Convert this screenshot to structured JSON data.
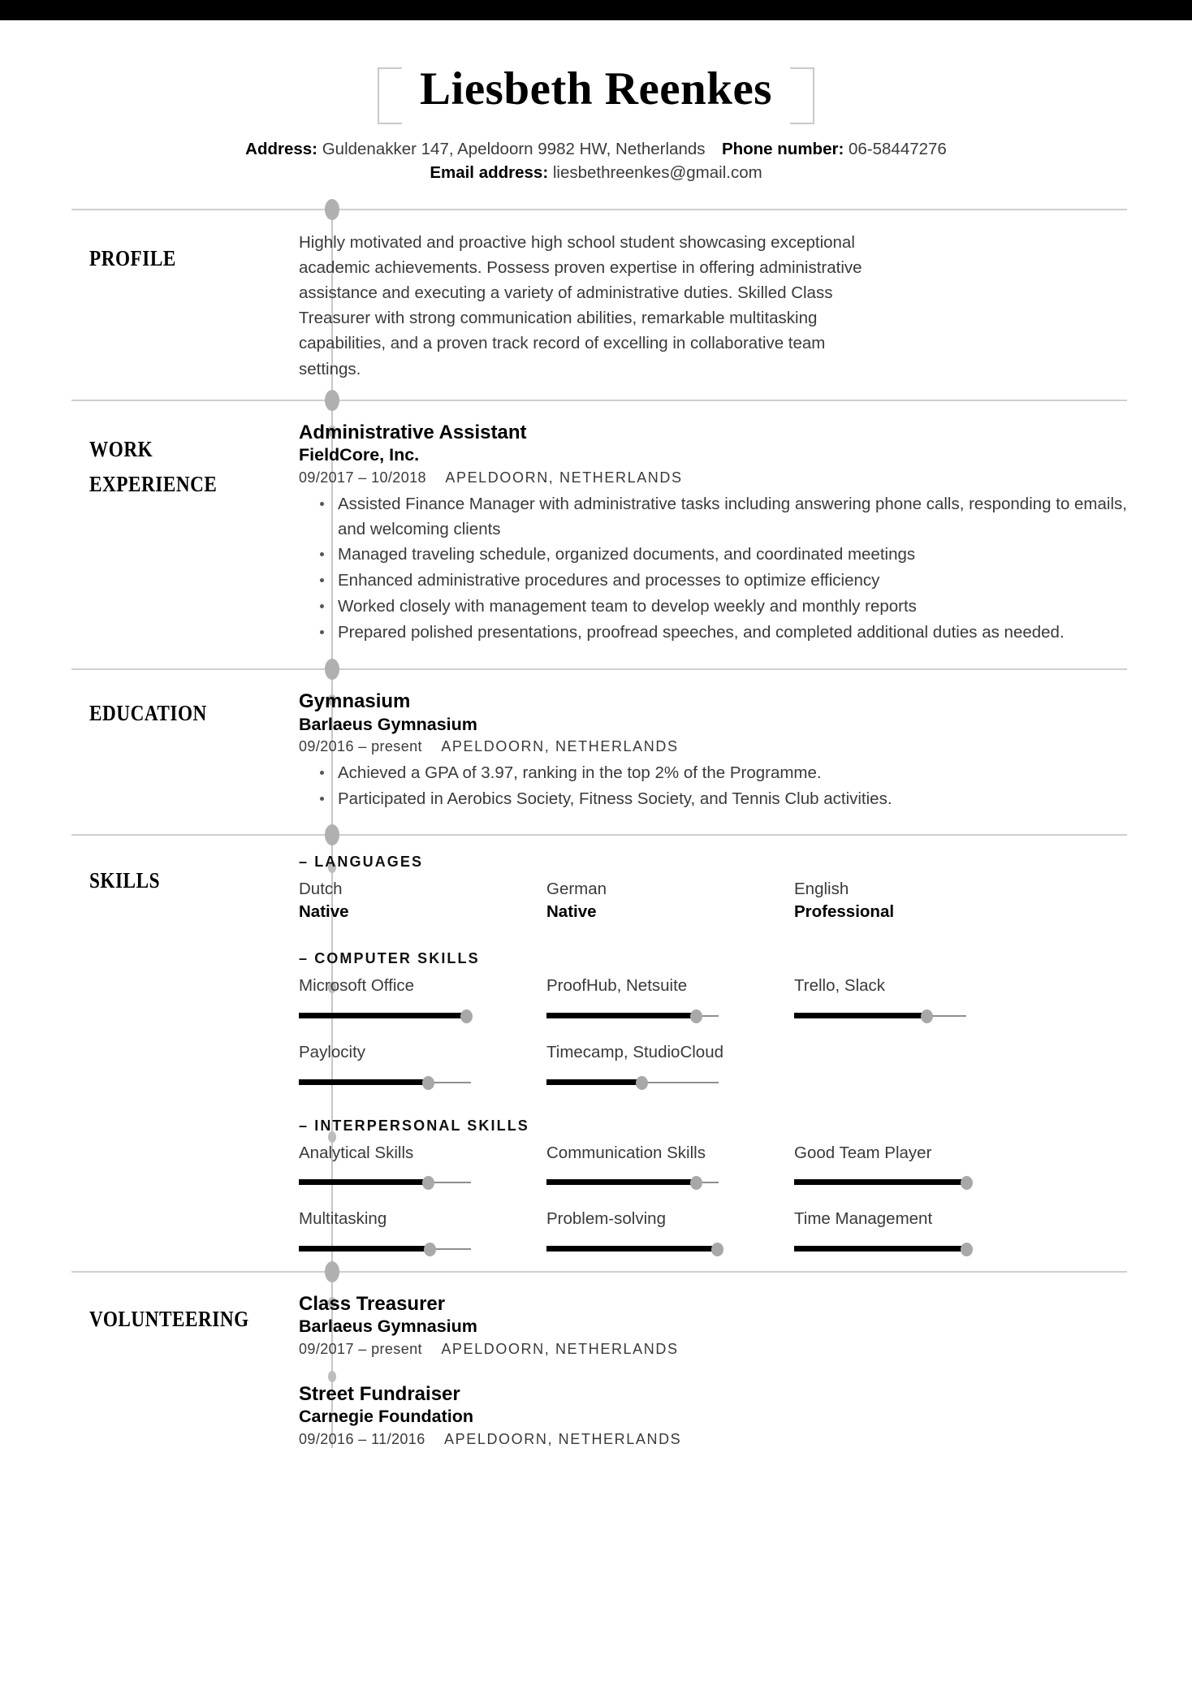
{
  "header": {
    "name": "Liesbeth Reenkes",
    "address_label": "Address:",
    "address_value": "Guldenakker 147, Apeldoorn 9982 HW, Netherlands",
    "phone_label": "Phone number:",
    "phone_value": "06-58447276",
    "email_label": "Email address:",
    "email_value": "liesbethreenkes@gmail.com"
  },
  "sections": {
    "profile": {
      "label": "PROFILE",
      "text": "Highly motivated and proactive high school student showcasing exceptional academic achievements. Possess proven expertise in offering administrative assistance and executing a variety of administrative duties. Skilled Class Treasurer with strong communication abilities, remarkable multitasking capabilities, and a proven track record of excelling in collaborative team settings."
    },
    "work": {
      "label_line1": "WORK",
      "label_line2": "EXPERIENCE",
      "entries": [
        {
          "title": "Administrative Assistant",
          "org": "FieldCore, Inc.",
          "dates": "09/2017 – 10/2018",
          "location": "APELDOORN, NETHERLANDS",
          "bullets": [
            "Assisted Finance Manager with administrative tasks including answering phone calls, responding to emails, and welcoming clients",
            "Managed traveling schedule, organized documents, and coordinated meetings",
            "Enhanced administrative procedures and processes to optimize efficiency",
            "Worked closely with management team to develop weekly and monthly reports",
            "Prepared polished presentations, proofread speeches, and completed additional duties as needed."
          ]
        }
      ]
    },
    "education": {
      "label": "EDUCATION",
      "entries": [
        {
          "title": "Gymnasium",
          "org": "Barlaeus Gymnasium",
          "dates": "09/2016 – present",
          "location": "APELDOORN, NETHERLANDS",
          "bullets": [
            "Achieved a GPA of 3.97, ranking in the top 2% of the Programme.",
            "Participated in Aerobics Society, Fitness Society, and Tennis Club activities."
          ]
        }
      ]
    },
    "skills": {
      "label": "SKILLS",
      "groups": [
        {
          "title": "– LANGUAGES",
          "type": "language",
          "rows": [
            [
              {
                "label": "Dutch",
                "value": "Native"
              },
              {
                "label": "German",
                "value": "Native"
              },
              {
                "label": "English",
                "value": "Professional"
              }
            ]
          ]
        },
        {
          "title": "– COMPUTER SKILLS",
          "type": "rating",
          "rows": [
            [
              {
                "label": "Microsoft Office",
                "level": 97
              },
              {
                "label": "ProofHub, Netsuite",
                "level": 87
              },
              {
                "label": "Trello, Slack",
                "level": 77
              }
            ],
            [
              {
                "label": "Paylocity",
                "level": 75
              },
              {
                "label": "Timecamp, StudioCloud",
                "level": 55
              }
            ]
          ]
        },
        {
          "title": "– INTERPERSONAL SKILLS",
          "type": "rating",
          "rows": [
            [
              {
                "label": "Analytical Skills",
                "level": 75
              },
              {
                "label": "Communication Skills",
                "level": 87
              },
              {
                "label": "Good Team Player",
                "level": 100
              }
            ],
            [
              {
                "label": "Multitasking",
                "level": 76
              },
              {
                "label": "Problem-solving",
                "level": 99
              },
              {
                "label": "Time Management",
                "level": 100
              }
            ]
          ]
        }
      ]
    },
    "volunteering": {
      "label": "VOLUNTEERING",
      "entries": [
        {
          "title": "Class Treasurer",
          "org": "Barlaeus Gymnasium",
          "dates": "09/2017 – present",
          "location": "APELDOORN, NETHERLANDS"
        },
        {
          "title": "Street Fundraiser",
          "org": "Carnegie Foundation",
          "dates": "09/2016 – 11/2016",
          "location": "APELDOORN, NETHERLANDS"
        }
      ]
    }
  },
  "colors": {
    "rule": "#cfcfcf",
    "spine": "#c6c6c6",
    "dot": "#b0b0b0",
    "fill": "#000000",
    "track": "#8f8f8f"
  }
}
